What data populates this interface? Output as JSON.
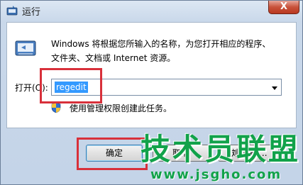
{
  "window": {
    "title": "运行",
    "close_glyph": "X",
    "icon": "run-app-icon"
  },
  "dialog": {
    "description_line1": "Windows 将根据您所输入的名称，为您打开相应的程序、",
    "description_line2": "文件夹、文档或 Internet 资源。",
    "open_label": "打开(O):",
    "open_value": "regedit",
    "admin_note": "使用管理权限创建此任务。"
  },
  "buttons": {
    "ok": "确定",
    "cancel": "取消",
    "browse": "浏览(B)..."
  },
  "watermark": {
    "main": "技术员联盟",
    "url": "www.jsgho.com"
  },
  "colors": {
    "highlight": "#d8303a",
    "watermark": "#11a24a",
    "selection": "#3399ff"
  }
}
